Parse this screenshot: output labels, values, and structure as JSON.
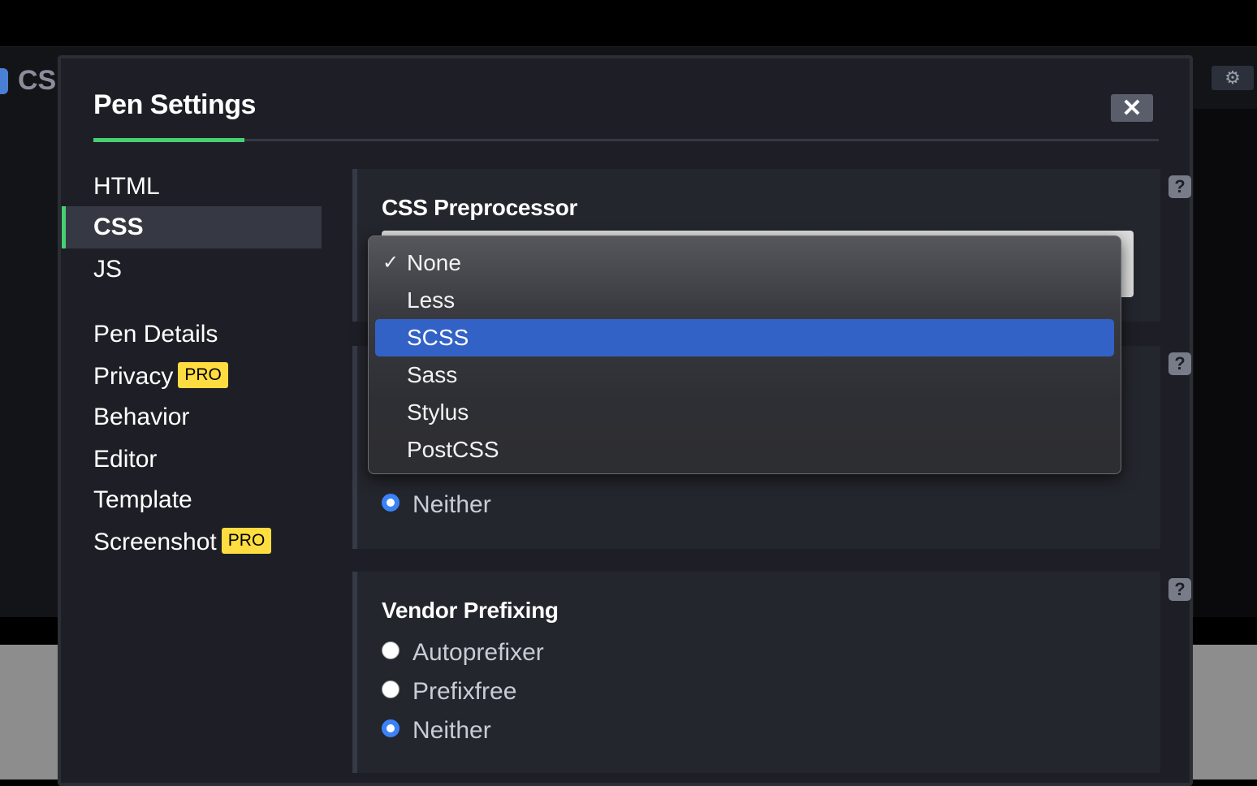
{
  "background": {
    "tab_label": "CSS",
    "gear_icon": "gear-icon"
  },
  "modal": {
    "title": "Pen Settings",
    "close_label": "✕"
  },
  "nav": {
    "items": [
      {
        "label": "HTML",
        "active": false
      },
      {
        "label": "CSS",
        "active": true
      },
      {
        "label": "JS",
        "active": false
      },
      {
        "label": "Pen Details",
        "active": false
      },
      {
        "label": "Privacy",
        "badge": "PRO"
      },
      {
        "label": "Behavior"
      },
      {
        "label": "Editor"
      },
      {
        "label": "Template"
      },
      {
        "label": "Screenshot",
        "badge": "PRO"
      }
    ]
  },
  "css_preprocessor": {
    "heading": "CSS Preprocessor",
    "help": "?",
    "selected": "None",
    "options": [
      "None",
      "Less",
      "SCSS",
      "Sass",
      "Stylus",
      "PostCSS"
    ],
    "highlighted": "SCSS",
    "check_mark": "✓"
  },
  "css_base": {
    "help": "?",
    "visible_option": "Neither"
  },
  "vendor_prefixing": {
    "heading": "Vendor Prefixing",
    "help": "?",
    "options": [
      "Autoprefixer",
      "Prefixfree",
      "Neither"
    ],
    "selected": "Neither"
  },
  "colors": {
    "accent_green": "#47cf73",
    "pro_yellow": "#ffdd40",
    "highlight_blue": "#3362c7",
    "radio_blue": "#3b82f6"
  }
}
